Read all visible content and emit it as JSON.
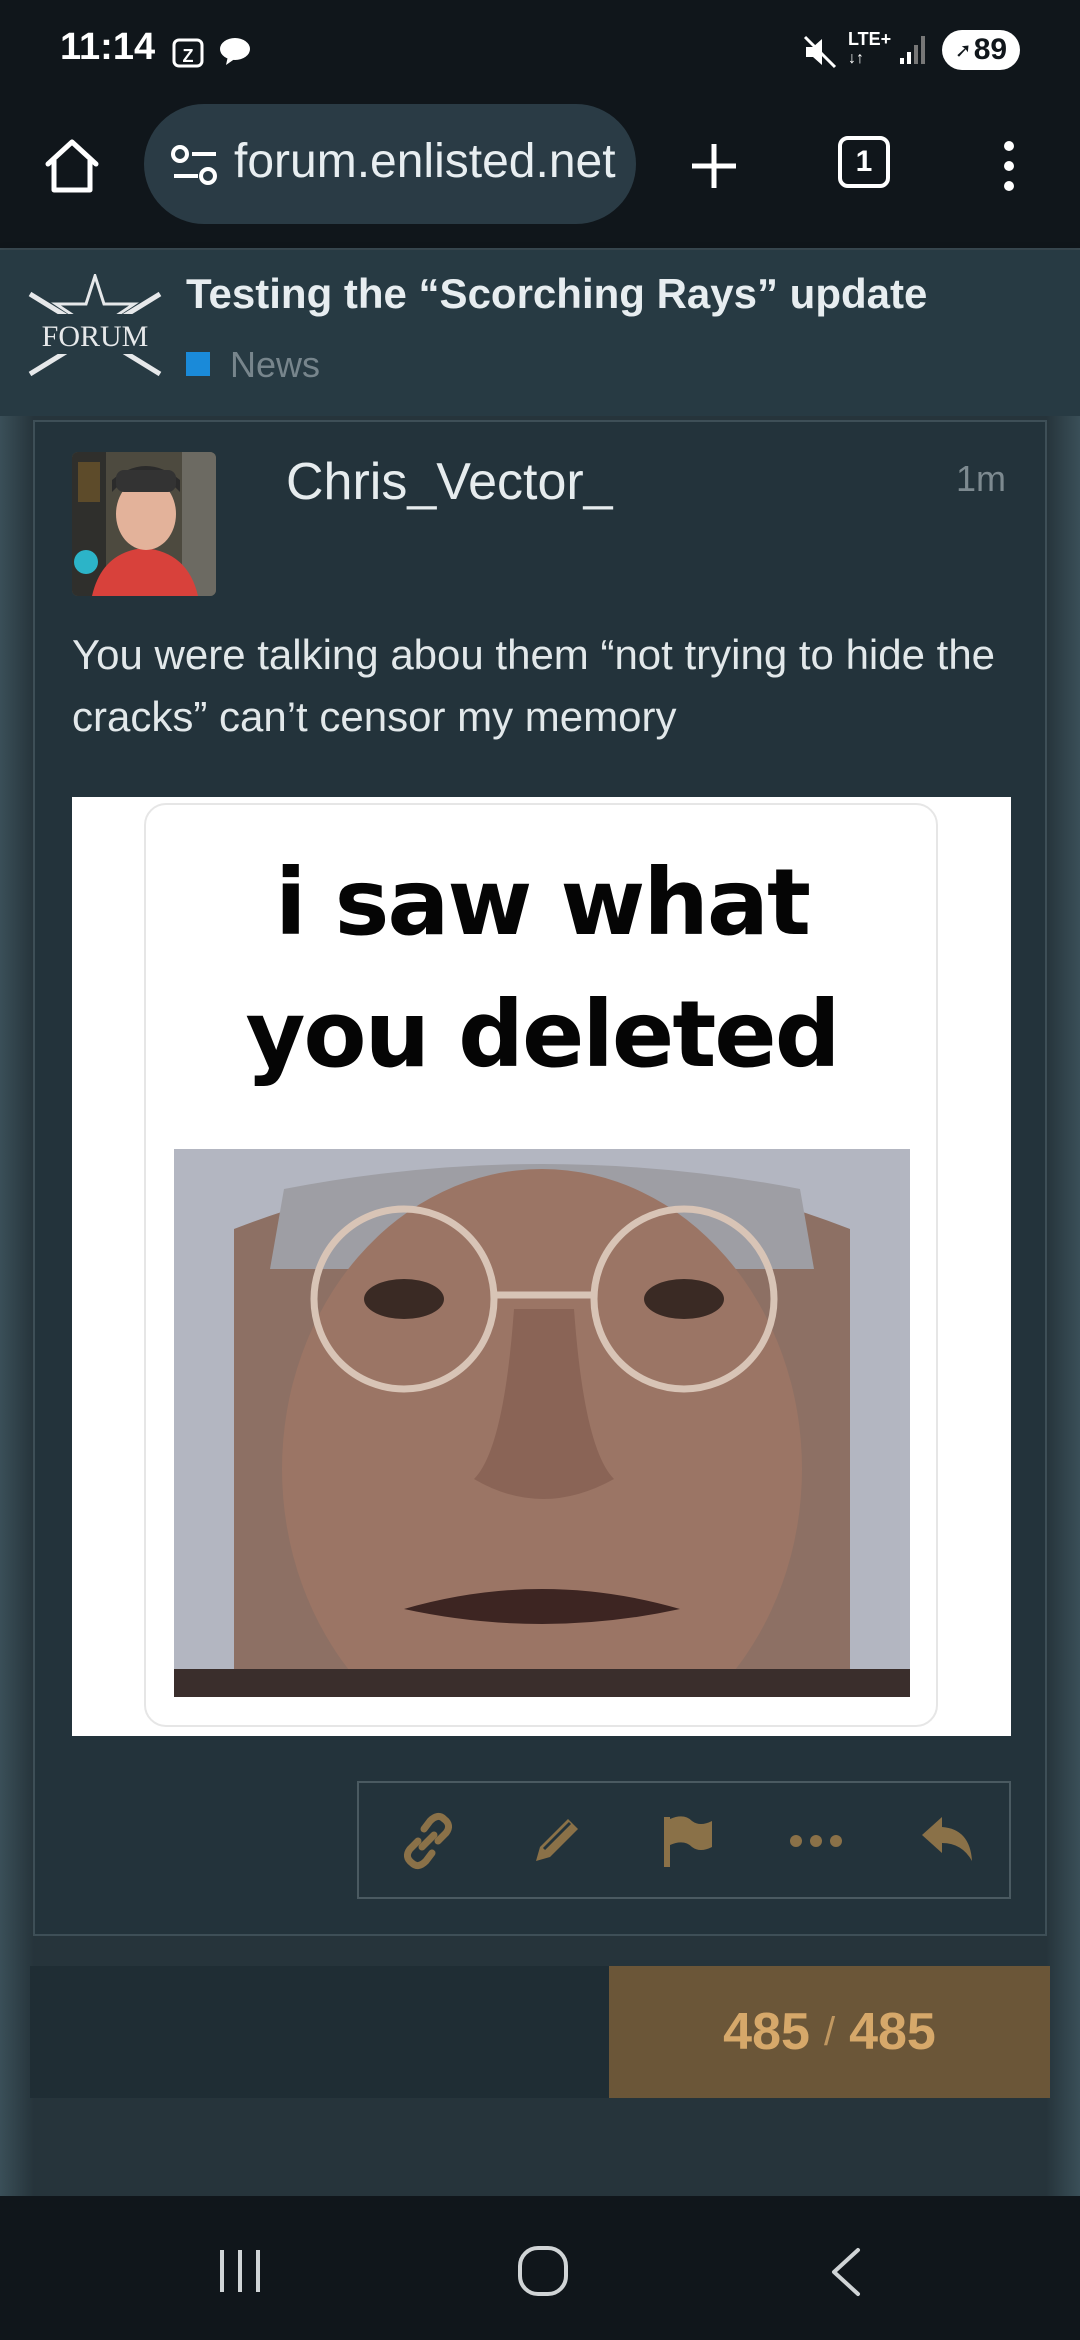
{
  "status_bar": {
    "time": "11:14",
    "battery": "89",
    "network": "LTE+",
    "icons": [
      "calendar-icon",
      "chat-bubble-icon",
      "mute-icon",
      "lte-icon",
      "signal-icon",
      "battery-icon"
    ]
  },
  "browser": {
    "url": "forum.enlisted.net",
    "tab_count": "1",
    "icons": [
      "home-icon",
      "site-settings-icon",
      "new-tab-icon",
      "tabs-icon",
      "menu-icon"
    ]
  },
  "topic": {
    "logo_text": "FORUM",
    "title": "Testing the “Scorching Rays” update",
    "category": "News",
    "category_color": "#1a8ad9"
  },
  "post": {
    "username": "Chris_Vector_",
    "time": "1m",
    "body": "You were talking abou them “not trying to hide the cracks” can’t censor my memory",
    "image": {
      "caption": "i saw what you deleted"
    },
    "actions": [
      "link-icon",
      "edit-icon",
      "flag-icon",
      "more-icon",
      "reply-icon"
    ],
    "accent_color": "#8a7148"
  },
  "progress": {
    "current": "485",
    "separator": "/",
    "total": "485"
  },
  "nav": [
    "recent-apps-icon",
    "home-circle-icon",
    "back-icon"
  ]
}
